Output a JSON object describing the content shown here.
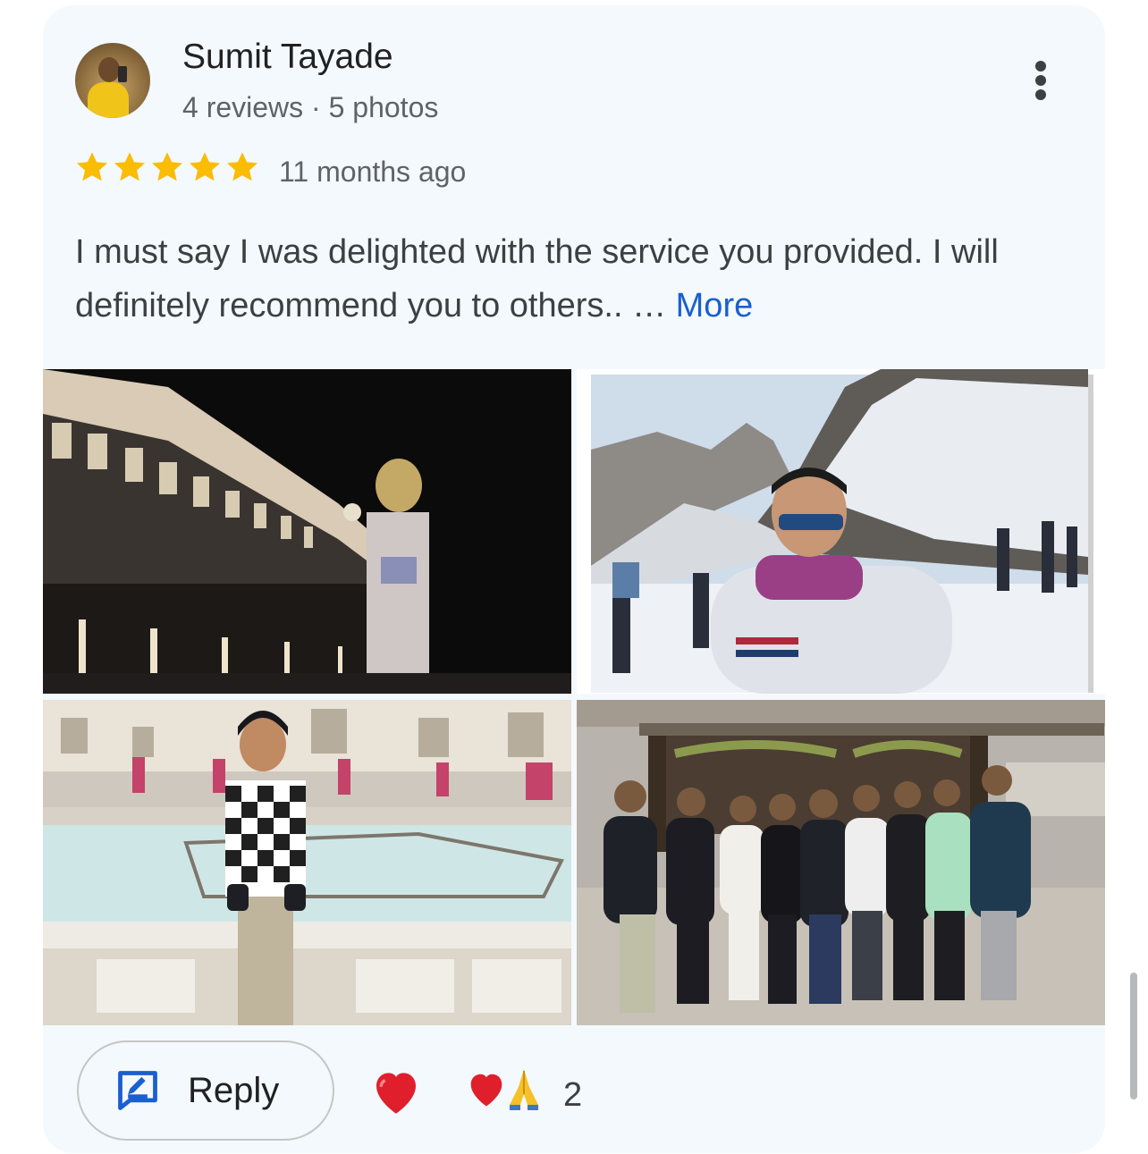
{
  "review": {
    "reviewer_name": "Sumit Tayade",
    "reviewer_meta": "4 reviews · 5 photos",
    "rating": 5,
    "time": "11 months ago",
    "text": "I must say I was delighted with the service you provided. I will definitely recommend you to others.. …",
    "more_label": "More"
  },
  "photos": [
    {
      "name": "photo-illuminated-gurudwara-night",
      "subject": "illuminated-building-at-night"
    },
    {
      "name": "photo-man-snow-mountains",
      "subject": "snow-mountain-valley"
    },
    {
      "name": "photo-man-fountain-courtyard",
      "subject": "marble-fountain-courtyard"
    },
    {
      "name": "photo-group-temple",
      "subject": "group-in-front-of-temple"
    }
  ],
  "actions": {
    "reply_label": "Reply",
    "reply_icon": "reply-edit-icon",
    "reaction_button_icon": "red-heart-icon",
    "reactions_summary": [
      "red-heart-icon",
      "folded-hands-icon"
    ],
    "reaction_count": "2"
  },
  "colors": {
    "card_background": "#f4f9fd",
    "star": "#fbbc04",
    "link": "#1a5fd0",
    "primary_text": "#202124",
    "secondary_text": "#5f6368"
  }
}
